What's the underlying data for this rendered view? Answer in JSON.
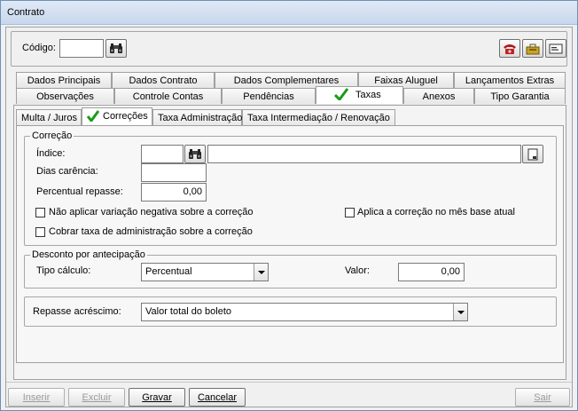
{
  "window": {
    "title": "Contrato"
  },
  "header": {
    "code_label": "Código:",
    "code_value": ""
  },
  "tabs_row1": [
    "Dados Principais",
    "Dados Contrato",
    "Dados Complementares",
    "Faixas Aluguel",
    "Lançamentos Extras"
  ],
  "tabs_row2": [
    "Observações",
    "Controle Contas",
    "Pendências",
    "Taxas",
    "Anexos",
    "Tipo Garantia"
  ],
  "subtabs": [
    "Multa / Juros",
    "Correções",
    "Taxa Administração",
    "Taxa Intermediação / Renovação"
  ],
  "correcao": {
    "group_label": "Correção",
    "indice_label": "Índice:",
    "indice_code": "",
    "indice_desc": "",
    "dias_label": "Dias carência:",
    "dias_value": "",
    "percentual_label": "Percentual repasse:",
    "percentual_value": "0,00",
    "chk_nao_aplicar": "Não aplicar variação negativa sobre a correção",
    "chk_aplica_mes": "Aplica a correção no mês base atual",
    "chk_cobrar_taxa": "Cobrar taxa de administração sobre a correção"
  },
  "desconto": {
    "group_label": "Desconto por antecipação",
    "tipo_label": "Tipo cálculo:",
    "tipo_value": "Percentual",
    "valor_label": "Valor:",
    "valor_value": "0,00"
  },
  "repasse": {
    "label": "Repasse acréscimo:",
    "value": "Valor total do boleto"
  },
  "footer": {
    "inserir": "Inserir",
    "excluir": "Excluir",
    "gravar": "Gravar",
    "cancelar": "Cancelar",
    "sair": "Sair"
  },
  "colors": {
    "check_green": "#1b9a1b",
    "underline_red": "#d01010"
  }
}
